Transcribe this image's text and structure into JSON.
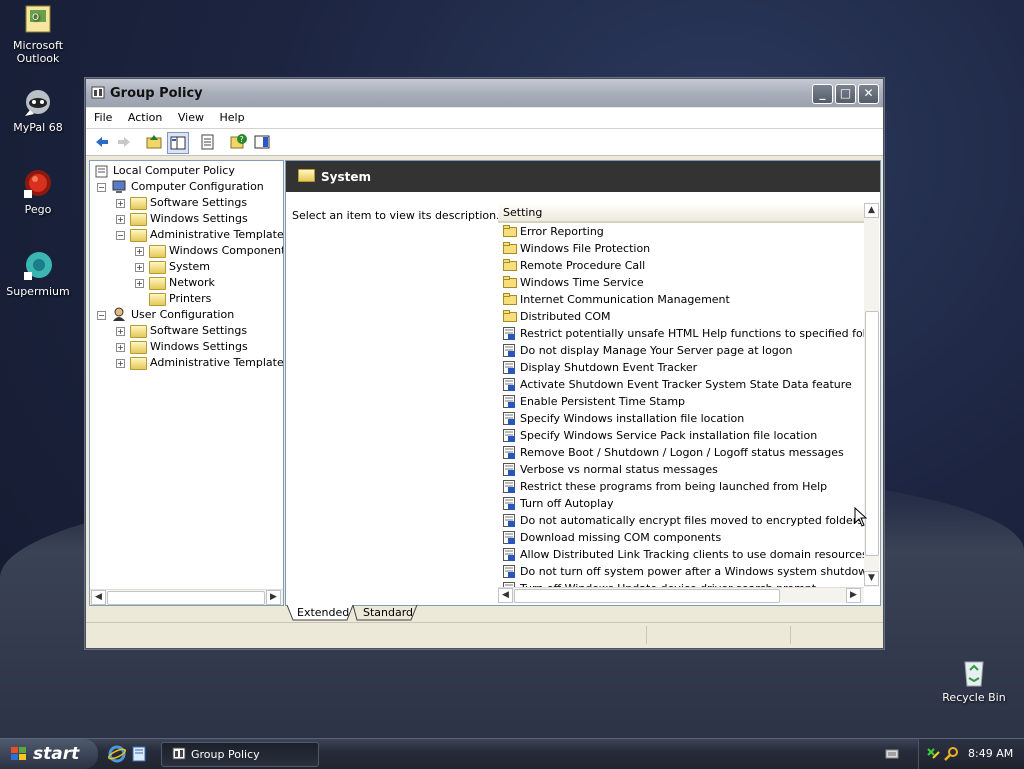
{
  "desktop": {
    "icons": [
      {
        "label1": "Microsoft",
        "label2": "Outlook"
      },
      {
        "label1": "MyPal 68",
        "label2": ""
      },
      {
        "label1": "Pego",
        "label2": ""
      },
      {
        "label1": "Supermium",
        "label2": ""
      },
      {
        "label1": "Recycle Bin",
        "label2": ""
      }
    ]
  },
  "window": {
    "title": "Group Policy",
    "menu": [
      "File",
      "Action",
      "View",
      "Help"
    ]
  },
  "tree": {
    "root": "Local Computer Policy",
    "computer_config": "Computer Configuration",
    "cc_software": "Software Settings",
    "cc_windows": "Windows Settings",
    "cc_admin": "Administrative Templates",
    "windows_components": "Windows Components",
    "system": "System",
    "network": "Network",
    "printers": "Printers",
    "user_config": "User Configuration",
    "uc_software": "Software Settings",
    "uc_windows": "Windows Settings",
    "uc_admin": "Administrative Templates"
  },
  "panel": {
    "header": "System",
    "description": "Select an item to view its description.",
    "column_header": "Setting",
    "folders": [
      "Error Reporting",
      "Windows File Protection",
      "Remote Procedure Call",
      "Windows Time Service",
      "Internet Communication Management",
      "Distributed COM"
    ],
    "settings": [
      "Restrict potentially unsafe HTML Help functions to specified folders",
      "Do not display Manage Your Server page at logon",
      "Display Shutdown Event Tracker",
      "Activate Shutdown Event Tracker System State Data feature",
      "Enable Persistent Time Stamp",
      "Specify Windows installation file location",
      "Specify Windows Service Pack installation file location",
      "Remove Boot / Shutdown / Logon / Logoff status messages",
      "Verbose vs normal status messages",
      "Restrict these programs from being launched from Help",
      "Turn off Autoplay",
      "Do not automatically encrypt files moved to encrypted folders",
      "Download missing COM components",
      "Allow Distributed Link Tracking clients to use domain resources",
      "Do not turn off system power after a Windows system shutdown ...",
      "Turn off Windows Update device driver search prompt"
    ],
    "tabs": [
      "Extended",
      "Standard"
    ]
  },
  "taskbar": {
    "start": "start",
    "task": "Group Policy",
    "clock": "8:49 AM"
  }
}
